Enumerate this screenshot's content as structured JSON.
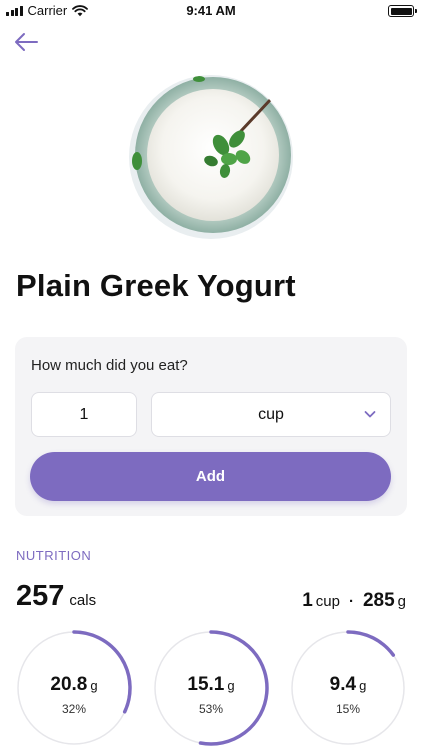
{
  "status_bar": {
    "carrier": "Carrier",
    "time": "9:41 AM"
  },
  "food": {
    "title": "Plain Greek Yogurt"
  },
  "portion": {
    "question": "How much did you eat?",
    "quantity": "1",
    "unit": "cup",
    "add_label": "Add"
  },
  "nutrition": {
    "heading": "NUTRITION",
    "calories": "257",
    "calories_unit": "cals",
    "serving_amount": "1",
    "serving_unit": "cup",
    "serving_weight": "285",
    "serving_weight_unit": "g",
    "macros": [
      {
        "value": "20.8",
        "unit": "g",
        "percent_label": "32%",
        "fraction": 0.32
      },
      {
        "value": "15.1",
        "unit": "g",
        "percent_label": "53%",
        "fraction": 0.53
      },
      {
        "value": "9.4",
        "unit": "g",
        "percent_label": "15%",
        "fraction": 0.15
      }
    ]
  },
  "colors": {
    "accent": "#7d6bc0",
    "card_bg": "#f4f4f6",
    "ring_track": "#e6e6ea"
  },
  "icons": {
    "back": "arrow-left-icon",
    "dropdown": "chevron-down-icon"
  }
}
